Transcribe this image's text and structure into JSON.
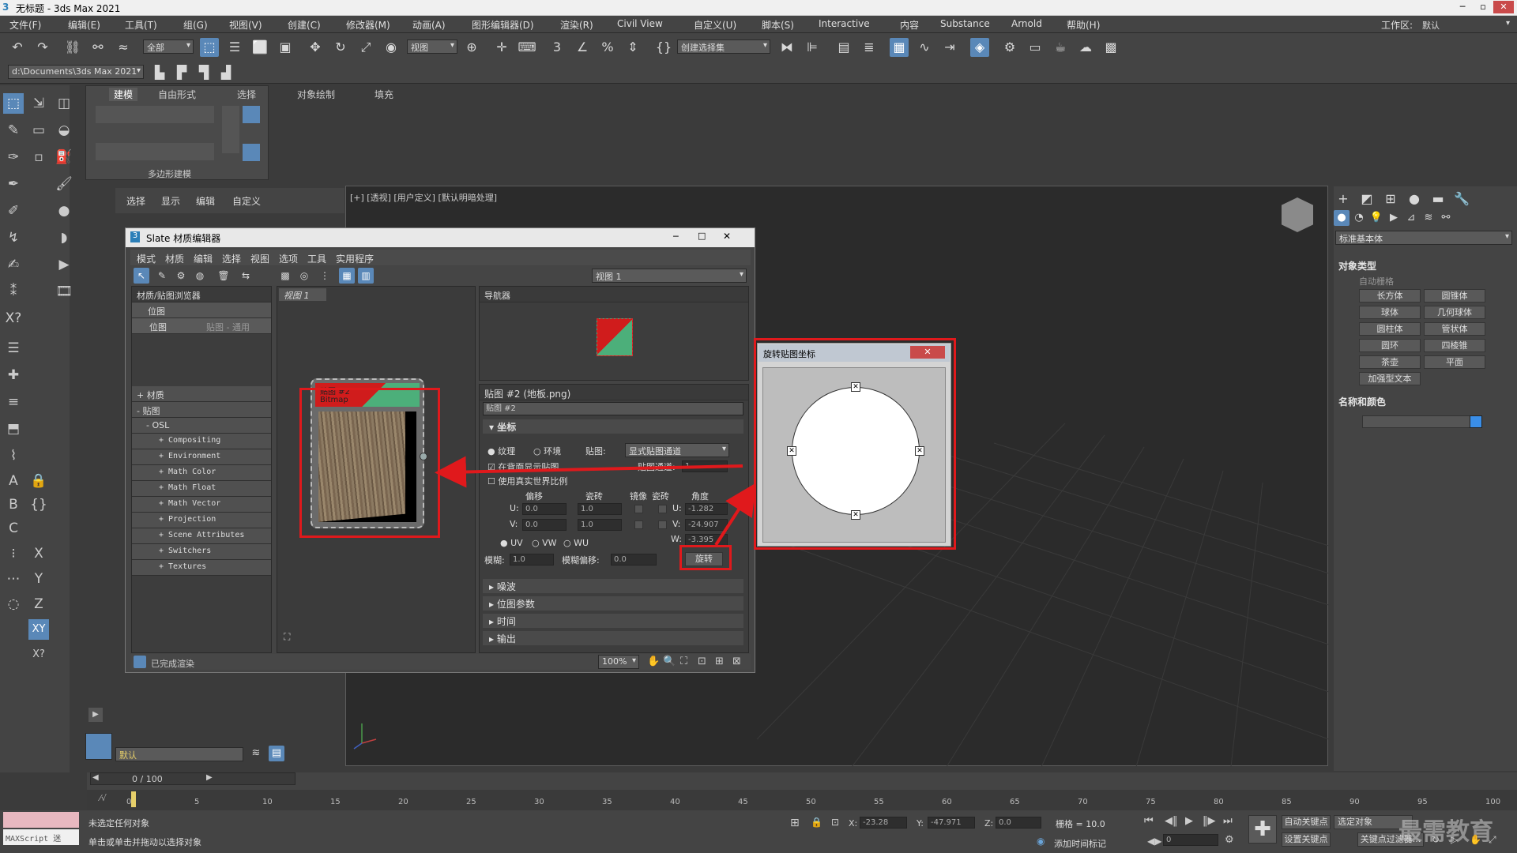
{
  "app": {
    "title": "无标题 - 3ds Max 2021",
    "workspace_label": "工作区:",
    "workspace_value": "默认"
  },
  "menu": [
    "文件(F)",
    "编辑(E)",
    "工具(T)",
    "组(G)",
    "视图(V)",
    "创建(C)",
    "修改器(M)",
    "动画(A)",
    "图形编辑器(D)",
    "渲染(R)",
    "Civil View",
    "自定义(U)",
    "脚本(S)",
    "Interactive",
    "内容",
    "Substance",
    "Arnold",
    "帮助(H)"
  ],
  "toolbar": {
    "filter_value": "全部",
    "refcoord_value": "视图",
    "named_sel_placeholder": "创建选择集",
    "project_path": "d:\\Documents\\3ds Max 2021"
  },
  "ribbon": {
    "tabs": [
      "建模",
      "自由形式",
      "选择",
      "对象绘制",
      "填充"
    ],
    "panel_label": "多边形建模"
  },
  "scene_explorer": {
    "menu": [
      "选择",
      "显示",
      "编辑",
      "自定义"
    ]
  },
  "viewport": {
    "label": "[+] [透视] [用户定义] [默认明暗处理]"
  },
  "slate": {
    "title": "Slate 材质编辑器",
    "menu": [
      "模式",
      "材质",
      "编辑",
      "选择",
      "视图",
      "选项",
      "工具",
      "实用程序"
    ],
    "view_dropdown": "视图 1",
    "browser_title": "材质/贴图浏览器",
    "browser_search": "位图",
    "browser_result_name": "位图",
    "browser_result_type": "贴图 - 通用",
    "browser_sections": [
      "+ 材质",
      "- 贴图",
      "- OSL"
    ],
    "osl_items": [
      "+ Compositing",
      "+ Environment",
      "+ Math Color",
      "+ Math Float",
      "+ Math Vector",
      "+ Projection",
      "+ Scene Attributes",
      "+ Switchers",
      "+ Textures"
    ],
    "view_tab": "视图 1",
    "node_title": "贴图 #2",
    "node_subtitle": "Bitmap",
    "navigator_title": "导航器",
    "params_title": "贴图 #2 (地板.png)",
    "params_name": "贴图 #2",
    "status": "已完成渲染",
    "zoom": "100%"
  },
  "coords": {
    "rollout": "坐标",
    "texture": "纹理",
    "environ": "环境",
    "mapping_label": "贴图:",
    "mapping_value": "显式贴图通道",
    "show_back": "在背面显示贴图",
    "map_channel_label": "贴图通道:",
    "map_channel_value": "1",
    "real_world": "使用真实世界比例",
    "col_offset": "偏移",
    "col_tiling": "瓷砖",
    "col_mirror": "镜像",
    "col_tile": "瓷砖",
    "col_angle": "角度",
    "u_label": "U:",
    "v_label": "V:",
    "w_label": "W:",
    "u_offset": "0.0",
    "v_offset": "0.0",
    "u_tiling": "1.0",
    "v_tiling": "1.0",
    "u_angle": "-1.282",
    "v_angle": "-24.907",
    "w_angle": "-3.395",
    "uv": "UV",
    "vw": "VW",
    "wu": "WU",
    "blur_label": "模糊:",
    "blur_value": "1.0",
    "blur_offset_label": "模糊偏移:",
    "blur_offset_value": "0.0",
    "rotate_button": "旋转"
  },
  "rollouts": [
    "噪波",
    "位图参数",
    "时间",
    "输出"
  ],
  "rotate_dialog": {
    "title": "旋转贴图坐标"
  },
  "command_panel": {
    "category": "标准基本体",
    "object_type_header": "对象类型",
    "autogrid": "自动栅格",
    "buttons": [
      "长方体",
      "圆锥体",
      "球体",
      "几何球体",
      "圆柱体",
      "管状体",
      "圆环",
      "四棱锥",
      "茶壶",
      "平面",
      "加强型文本"
    ],
    "name_color_header": "名称和颜色"
  },
  "timeline": {
    "frame_counter": "0 / 100",
    "ticks": [
      "0",
      "5",
      "10",
      "15",
      "20",
      "25",
      "30",
      "35",
      "40",
      "45",
      "50",
      "55",
      "60",
      "65",
      "70",
      "75",
      "80",
      "85",
      "90",
      "95",
      "100"
    ]
  },
  "layer": {
    "value": "默认"
  },
  "status": {
    "maxscript": "MAXScript 迷",
    "line1": "未选定任何对象",
    "line2": "单击或单击并拖动以选择对象",
    "x_label": "X:",
    "x_value": "-23.28",
    "y_label": "Y:",
    "y_value": "-47.971",
    "z_label": "Z:",
    "z_value": "0.0",
    "grid": "栅格 = 10.0",
    "add_time_tag": "添加时间标记",
    "autokey": "自动关键点",
    "selected": "选定对象",
    "setkey": "设置关键点",
    "key_filters": "关键点过滤器...",
    "frame_value": "0"
  },
  "watermark": "最需教育",
  "colors": {
    "highlight_red": "#e0191c",
    "selection_blue": "#5a88b8"
  }
}
